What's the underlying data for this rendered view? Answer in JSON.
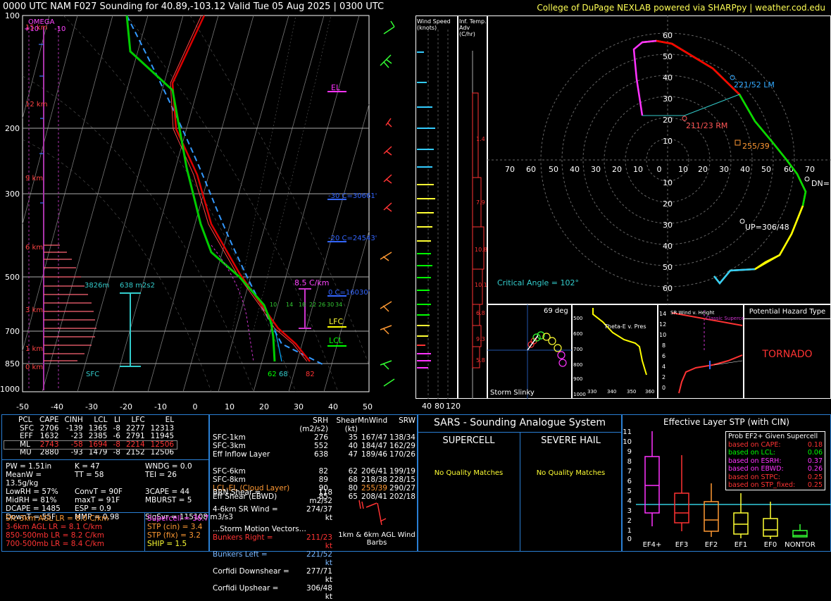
{
  "header": {
    "title": "0000 UTC NAM F027 Sounding for 40.89,-103.12 Valid  Tue 05 Aug 2025 | 0300 UTC",
    "credit": "College of DuPage NEXLAB powered via SHARPpy | weather.cod.edu"
  },
  "skewt": {
    "pressure_labels": [
      "100",
      "200",
      "300",
      "500",
      "700",
      "850",
      "1000"
    ],
    "temp_labels": [
      "-50",
      "-40",
      "-30",
      "-20",
      "-10",
      "0",
      "10",
      "20",
      "30",
      "40",
      "50"
    ],
    "height_labels": [
      "15 km",
      "12 km",
      "9 km",
      "6 km",
      "3 km",
      "1 km",
      "0 km"
    ],
    "omega_label": "OMEGA",
    "omega_left": "+10",
    "omega_right": "-10",
    "el_label": "EL",
    "lfc_label": "LFC",
    "lcl_label": "LCL",
    "iso_m30": "-30 C=30661'",
    "iso_m20": "-20 C=24543'",
    "iso_0": "0 C=16030'",
    "lr_label": "8.5 C/km",
    "eff_depth": "3826m",
    "eff_srh": "638 m2s2",
    "sfc_label": "SFC",
    "sfc_td": "62",
    "sfc_twb": "68",
    "sfc_t": "82",
    "mixratio_labels": [
      "10",
      "14",
      "18",
      "22",
      "26",
      "30",
      "34"
    ]
  },
  "wind_speed": {
    "title": "Wind Speed (knots)",
    "ticks": [
      "40",
      "80",
      "120"
    ]
  },
  "temp_adv": {
    "title": "Inf. Temp. Adv (C/hr)",
    "values": [
      "1.4",
      "7.9",
      "10.8",
      "10.1",
      "6.8",
      "9.3",
      "5.8"
    ]
  },
  "hodograph": {
    "ring_labels": [
      "10",
      "20",
      "30",
      "40",
      "50",
      "60"
    ],
    "axis_labels": [
      "70",
      "60",
      "50",
      "40",
      "30",
      "20",
      "10",
      "0",
      "10",
      "20",
      "30",
      "40",
      "50",
      "60",
      "70"
    ],
    "lm_label": "221/52 LM",
    "rm_label": "211/23 RM",
    "mean_label": "255/39",
    "dn_label": "DN=",
    "up_label": "UP=306/48",
    "critical_angle": "Critical Angle = 102°"
  },
  "storm_slinky": {
    "label": "Storm Slinky",
    "deg": "69 deg"
  },
  "theta_e": {
    "title": "Theta-E v. Pres",
    "pres_ticks": [
      "500",
      "600",
      "700",
      "800",
      "900",
      "1000"
    ],
    "x_ticks": [
      "330",
      "340",
      "350",
      "360"
    ]
  },
  "sr_wind": {
    "title": "SR Wind v. Height",
    "supercell_label": "Classic Supercell",
    "height_ticks": [
      "14",
      "12",
      "10",
      "8",
      "6",
      "4",
      "2",
      "0"
    ]
  },
  "hazard": {
    "title": "Potential Hazard Type",
    "value": "TORNADO"
  },
  "parcels": {
    "headers": [
      "PCL",
      "CAPE",
      "CINH",
      "LCL",
      "LI",
      "LFC",
      "EL"
    ],
    "rows": [
      [
        "SFC",
        "2706",
        "-139",
        "1365",
        "-8",
        "2277",
        "12313"
      ],
      [
        "EFF",
        "1632",
        "-23",
        "2385",
        "-6",
        "2791",
        "11945"
      ],
      [
        "ML",
        "2743",
        "-58",
        "1694",
        "-8",
        "2214",
        "12506"
      ],
      [
        "MU",
        "2880",
        "-93",
        "1479",
        "-8",
        "2152",
        "12506"
      ]
    ]
  },
  "thermo": [
    [
      "PW = 1.51in",
      "K = 47",
      "WNDG = 0.0"
    ],
    [
      "MeanW = 13.5g/kg",
      "TT = 58",
      "TEI = 26"
    ],
    [
      "LowRH = 57%",
      "ConvT = 90F",
      "3CAPE = 44"
    ],
    [
      "MidRH = 81%",
      "maxT = 91F",
      "MBURST = 5"
    ],
    [
      "DCAPE = 1485",
      "ESP = 0.9",
      ""
    ],
    [
      "DownT = 55F",
      "MMP = 0.98",
      "SigSvr = 115108 m3/s3"
    ]
  ],
  "lapse_rates": [
    "Sfc-3km AGL LR = 8.0 C/km",
    "3-6km AGL LR = 8.1 C/km",
    "850-500mb LR = 8.2 C/km",
    "700-500mb LR = 8.4 C/km"
  ],
  "composite": [
    "Supercell = 36.7",
    "STP (cin) = 3.4",
    "STP (fix) = 3.2",
    "SHIP = 1.5"
  ],
  "kinematics": {
    "headers": [
      "SRH (m2/s2)",
      "Shear (kt)",
      "MnWind",
      "SRW"
    ],
    "rows": [
      [
        "SFC-1km",
        "276",
        "35",
        "167/47",
        "138/34"
      ],
      [
        "SFC-3km",
        "552",
        "40",
        "184/47",
        "162/29"
      ],
      [
        "Eff Inflow Layer",
        "638",
        "47",
        "189/46",
        "170/26"
      ],
      [
        "",
        "",
        "",
        "",
        ""
      ],
      [
        "SFC-6km",
        "82",
        "62",
        "206/41",
        "199/19"
      ],
      [
        "SFC-8km",
        "89",
        "68",
        "218/38",
        "228/15"
      ],
      [
        "LCL-EL (Cloud Layer)",
        "90",
        "80",
        "255/39",
        "290/27"
      ],
      [
        "Eff Shear (EBWD)",
        "85",
        "65",
        "208/41",
        "202/18"
      ]
    ],
    "brn_shear": "BRN Shear =",
    "brn_val": "118 m2/s2",
    "srwind_46": "4-6km SR Wind =",
    "srwind_46_val": "274/37 kt",
    "storm_vectors_title": "...Storm Motion Vectors...",
    "bunkers_right": "Bunkers Right =",
    "bunkers_right_val": "211/23 kt",
    "bunkers_left": "Bunkers Left =",
    "bunkers_left_val": "221/52 kt",
    "corfidi_down": "Corfidi Downshear =",
    "corfidi_down_val": "277/71 kt",
    "corfidi_up": "Corfidi Upshear =",
    "corfidi_up_val": "306/48 kt",
    "barbs_label": "1km & 6km AGL Wind Barbs"
  },
  "sars": {
    "title": "SARS - Sounding Analogue System",
    "supercell": "SUPERCELL",
    "hail": "SEVERE HAIL",
    "no_match": "No Quality Matches"
  },
  "stp": {
    "title": "Effective Layer STP (with CIN)",
    "y_ticks": [
      "11",
      "10",
      "9",
      "8",
      "7",
      "6",
      "5",
      "4",
      "3",
      "2",
      "1",
      "0"
    ],
    "categories": [
      "EF4+",
      "EF3",
      "EF2",
      "EF1",
      "EF0",
      "NONTOR"
    ],
    "prob_title": "Prob EF2+ Given Supercell",
    "probs": [
      [
        "based on CAPE:",
        "0.18"
      ],
      [
        "based on LCL:",
        "0.06"
      ],
      [
        "based on ESRH:",
        "0.37"
      ],
      [
        "based on EBWD:",
        "0.26"
      ],
      [
        "based on STPC:",
        "0.25"
      ],
      [
        "based on STP_fixed:",
        "0.25"
      ]
    ]
  }
}
